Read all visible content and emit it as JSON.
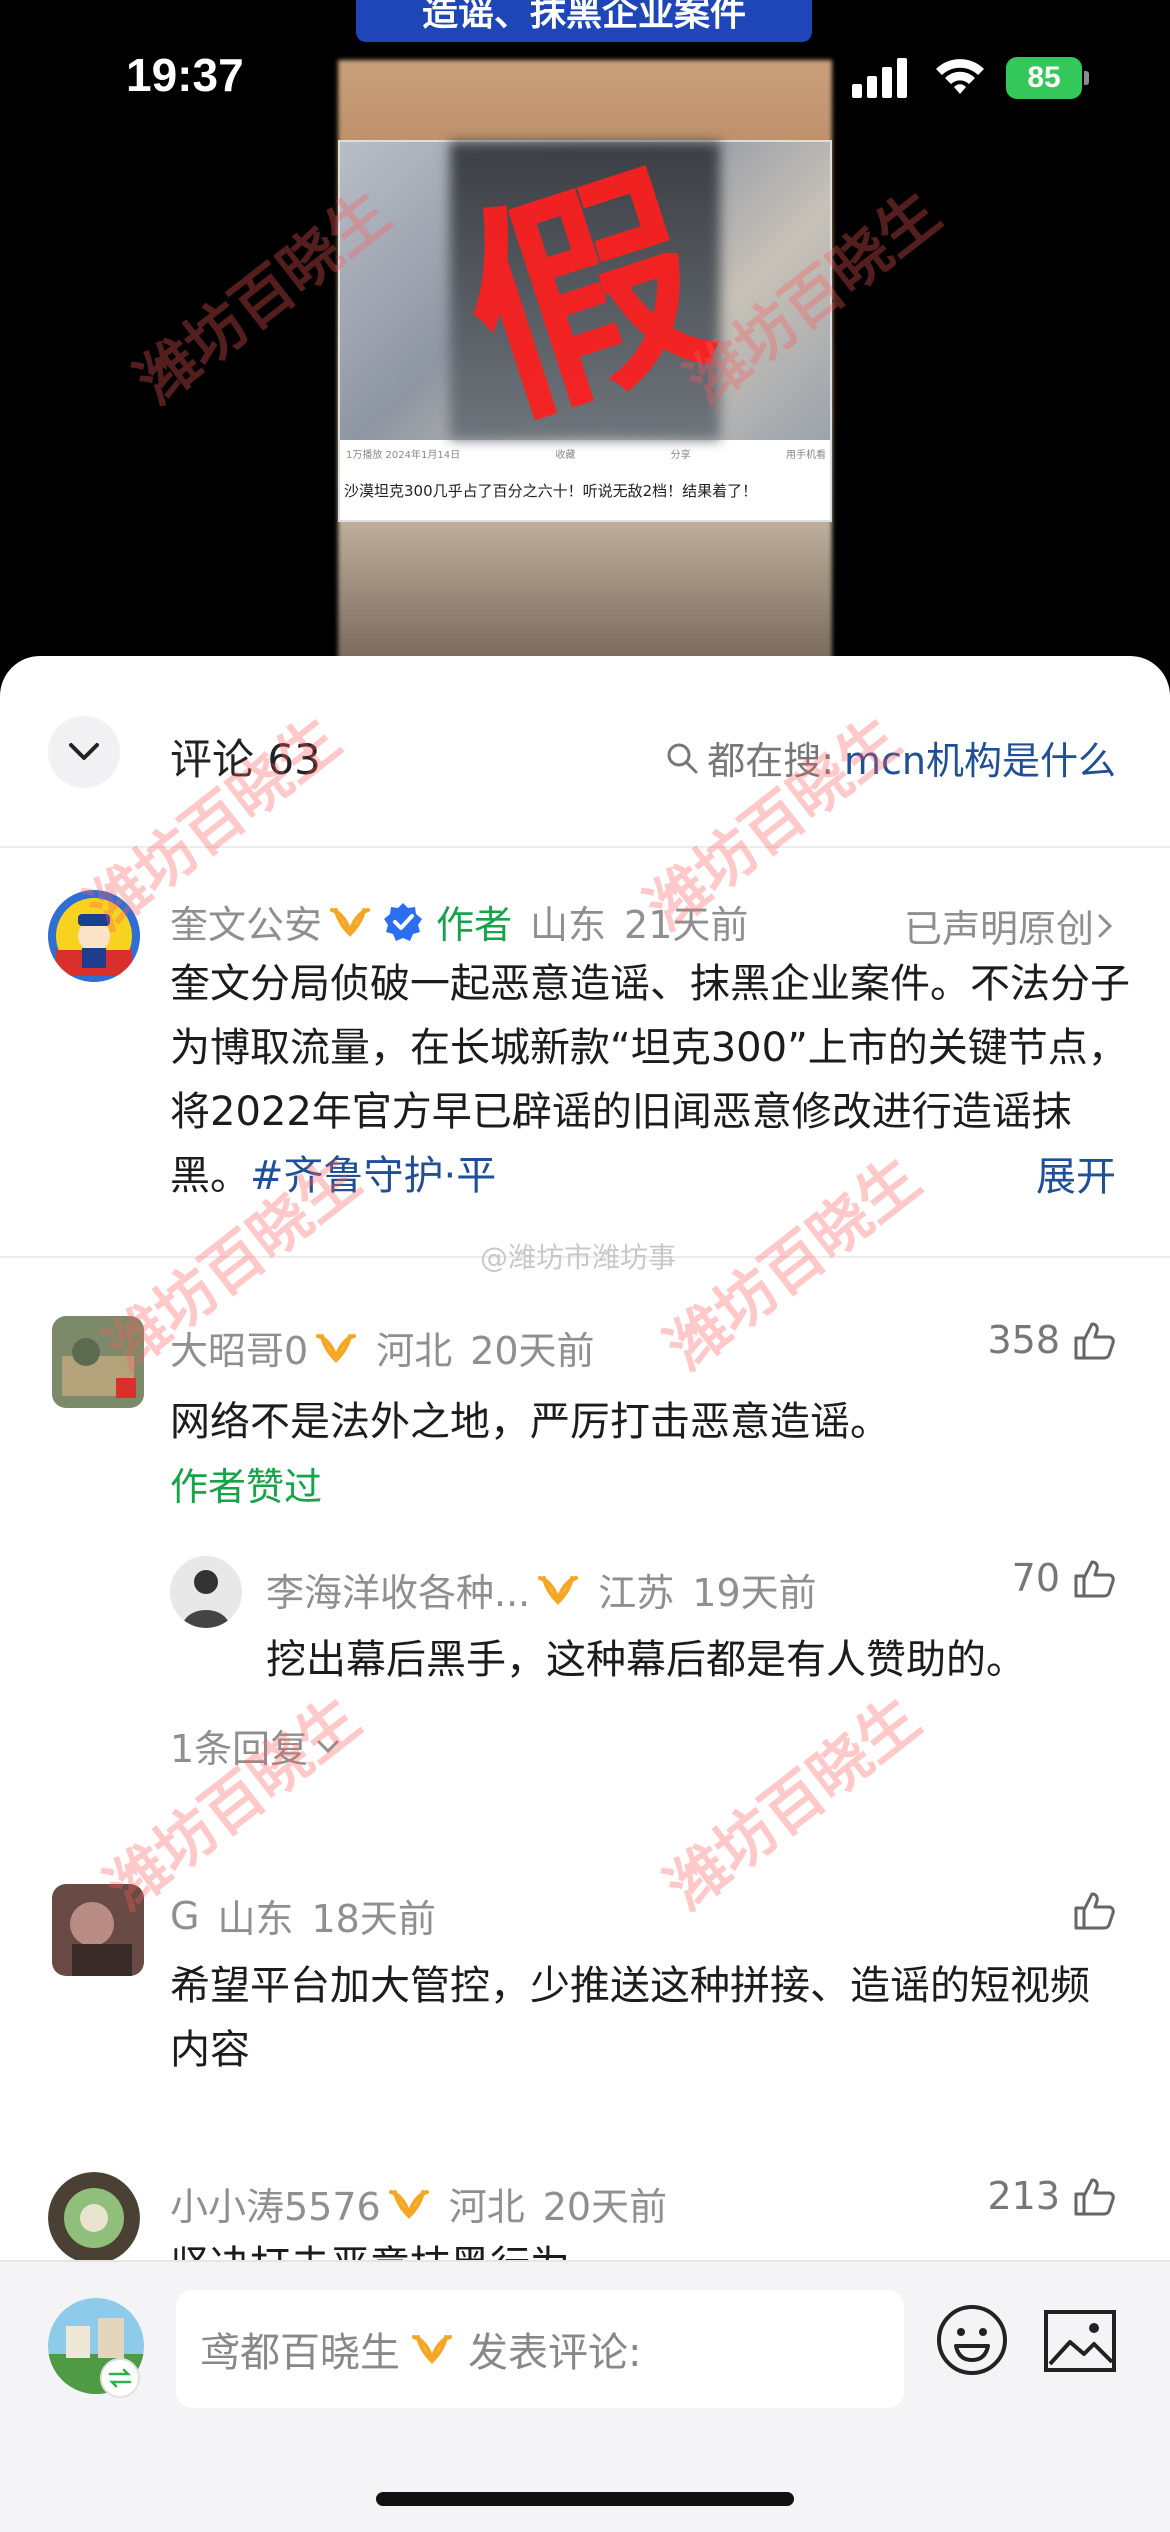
{
  "status_bar": {
    "time": "19:37",
    "battery": "85"
  },
  "video": {
    "banner": "造谣、抹黑企业案件",
    "stamp": "假",
    "meta_left": "1万播放 2024年1月14日",
    "meta_actions": [
      "收藏",
      "分享",
      "用手机看"
    ],
    "caption": "沙漠坦克300几乎占了百分之六十！听说无敌2档！结果着了！"
  },
  "header": {
    "title": "评论 63",
    "search_prefix": "都在搜:",
    "search_term": "mcn机构是什么"
  },
  "author_comment": {
    "username": "奎文公安",
    "badge": "作者",
    "location": "山东",
    "time": "21天前",
    "declared": "已声明原创",
    "text": "奎文分局侦破一起恶意造谣、抹黑企业案件。不法分子为博取流量，在长城新款“坦克300”上市的关键节点，将2022年官方早已辟谣的旧闻恶意修改进行造谣抹黑。",
    "tag": "#齐鲁守护·平",
    "expand": "展开"
  },
  "watermark_weibo": "@潍坊市潍坊事",
  "comments": [
    {
      "username": "大昭哥0",
      "location": "河北",
      "time": "20天前",
      "likes": "358",
      "text": "网络不是法外之地，严厉打击恶意造谣。",
      "author_liked": "作者赞过",
      "reply": {
        "username": "李海洋收各种...",
        "location": "江苏",
        "time": "19天前",
        "likes": "70",
        "text": "挖出幕后黑手，这种幕后都是有人赞助的。"
      },
      "replies_link": "1条回复"
    },
    {
      "username": "G",
      "location": "山东",
      "time": "18天前",
      "likes": "",
      "text": "希望平台加大管控，少推送这种拼接、造谣的短视频内容"
    },
    {
      "username": "小小涛5576",
      "location": "河北",
      "time": "20天前",
      "likes": "213",
      "text": "坚决打击恶意抹黑行为"
    }
  ],
  "watermark_text": "潍坊百晓生",
  "bottom_bar": {
    "my_name": "鸢都百晓生",
    "input_placeholder": "发表评论:"
  },
  "colors": {
    "link_blue": "#1f4f96",
    "author_green": "#16a34a",
    "vip_orange": "#f5a623",
    "battery_green": "#34c759"
  }
}
